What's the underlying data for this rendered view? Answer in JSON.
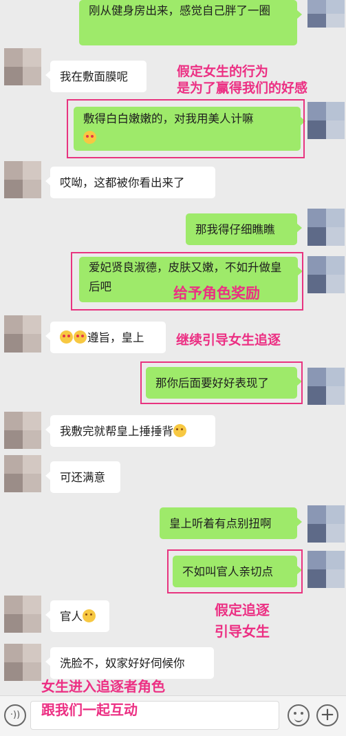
{
  "messages": [
    {
      "side": "right",
      "text": "刚从健身房出来，感觉自己胖了一圈"
    },
    {
      "side": "left",
      "text": "我在敷面膜呢"
    },
    {
      "side": "right",
      "text": "敷得白白嫩嫩的，对我用美人计嘛",
      "emoji": "😍"
    },
    {
      "side": "left",
      "text": "哎呦，这都被你看出来了"
    },
    {
      "side": "right",
      "text": "那我得仔细瞧瞧"
    },
    {
      "side": "right",
      "text": "爱妃贤良淑德，皮肤又嫩，不如升做皇后吧"
    },
    {
      "side": "left",
      "text": "遵旨，皇上",
      "emoji": "😍😍"
    },
    {
      "side": "right",
      "text": "那你后面要好好表现了"
    },
    {
      "side": "left",
      "text": "我敷完就帮皇上捶捶背",
      "emoji": "🧐"
    },
    {
      "side": "left",
      "text": "可还满意"
    },
    {
      "side": "right",
      "text": "皇上听着有点别扭啊"
    },
    {
      "side": "right",
      "text": "不如叫官人亲切点"
    },
    {
      "side": "left",
      "text": "官人",
      "emoji": "😳"
    },
    {
      "side": "left",
      "text": "洗脸不，奴家好好伺候你"
    }
  ],
  "annotations": {
    "a1_line1": "假定女生的行为",
    "a1_line2": "是为了赢得我们的好感",
    "a2": "给予角色奖励",
    "a3": "继续引导女生追逐",
    "a4_line1": "假定追逐",
    "a4_line2": "引导女生",
    "a5_line1": "女生进入追逐者角色",
    "a5_line2": "跟我们一起互动"
  },
  "input_bar": {
    "voice_label": "·))",
    "plus_label": "+"
  },
  "colors": {
    "sent_bubble": "#9eea6a",
    "received_bubble": "#ffffff",
    "annotation": "#ec2f83",
    "background": "#ebebeb"
  },
  "icons": [
    "voice-icon",
    "emoji-icon",
    "plus-icon"
  ]
}
